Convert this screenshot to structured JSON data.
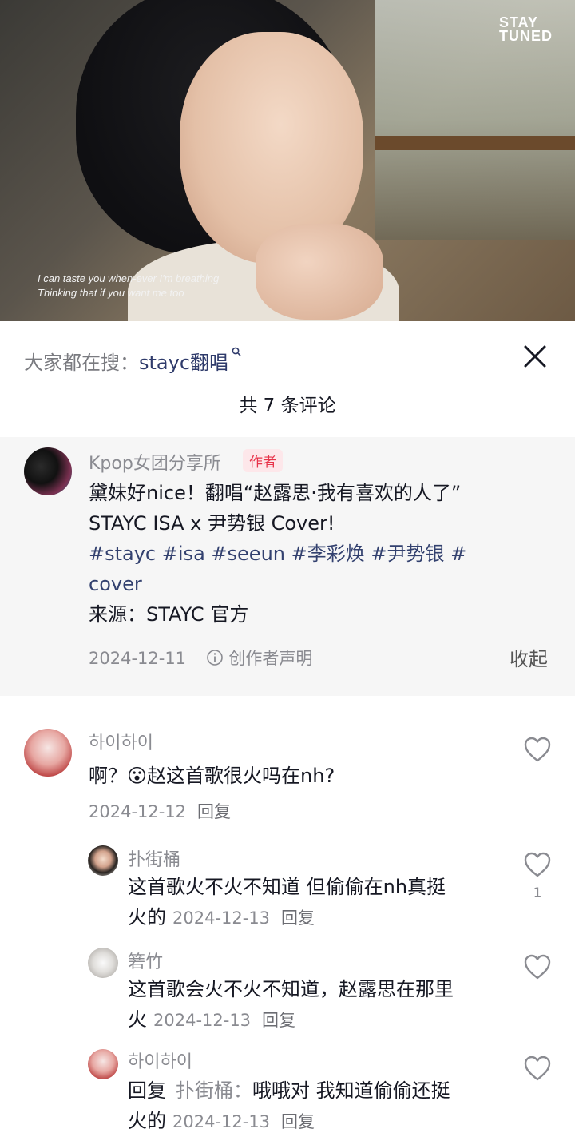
{
  "video": {
    "brand_line1": "STAY",
    "brand_line2": "TUNED",
    "lyric_line1": "I can taste you when-ever I'm breathing",
    "lyric_line2": "Thinking that if you want me too"
  },
  "header": {
    "search_prefix": "大家都在搜：",
    "search_keyword": "stayc翻唱",
    "comment_count": "共 7 条评论"
  },
  "author_post": {
    "username": "Kpop女团分享所",
    "badge": "作者",
    "text_line1": "黛妹好nice！翻唱“赵露思·我有喜欢的人了”",
    "text_line2": "STAYC ISA x 尹势银 Cover!",
    "tags": [
      "#stayc",
      "#isa",
      "#seeun",
      "#李彩焕",
      "#尹势银",
      "#",
      "cover"
    ],
    "source": "来源：STAYC 官方",
    "date": "2024-12-11",
    "statement": "创作者声明",
    "collapse": "收起"
  },
  "comments": [
    {
      "username": "하이하이",
      "emoji": "😮",
      "text_before_emoji": "啊？",
      "text_after_emoji": "赵这首歌很火吗在nh?",
      "date": "2024-12-12",
      "reply": "回复",
      "replies": [
        {
          "username": "扑街桶",
          "line1": "这首歌火不火不知道 但偷偷在nh真挺",
          "line2": "火的",
          "date": "2024-12-13",
          "reply": "回复",
          "likes": "1"
        },
        {
          "username": "箬竹",
          "line1": "这首歌会火不火不知道，赵露思在那里",
          "line2": "火",
          "date": "2024-12-13",
          "reply": "回复",
          "likes": ""
        },
        {
          "username": "하이하이",
          "reply_prefix": "回复",
          "reply_to": "扑街桶：",
          "line1": "哦哦对 我知道偷偷还挺",
          "line2": "火的",
          "date": "2024-12-13",
          "reply": "回复",
          "likes": ""
        }
      ]
    }
  ],
  "colors": {
    "accent_tag": "#33416f",
    "badge_bg": "#fde7ea",
    "badge_text": "#e8334a",
    "muted": "#8a8b91"
  },
  "icons": {
    "close": "close-icon",
    "search": "search-icon",
    "like": "heart-icon",
    "info": "info-icon"
  }
}
